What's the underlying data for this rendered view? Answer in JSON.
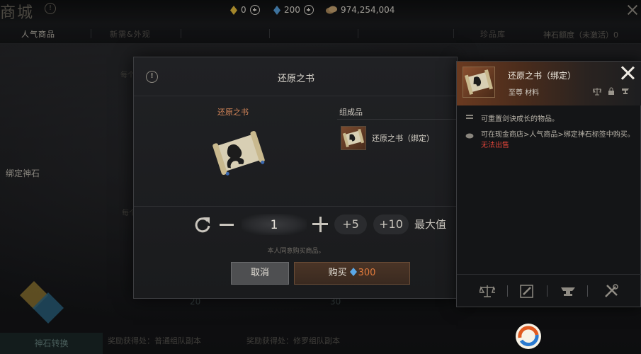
{
  "header": {
    "title": "商城",
    "help_icon": "!",
    "currencies": [
      {
        "icon": "gold-gem-icon",
        "value": "0",
        "color": "#f0c640"
      },
      {
        "icon": "blue-gem-icon",
        "value": "200",
        "color": "#5aa8e8"
      },
      {
        "icon": "coin-icon",
        "value": "974,254,004",
        "color": "#c9a46a"
      }
    ]
  },
  "tabs": [
    "人气商品",
    "新需&外观",
    "",
    "",
    "",
    "珍品库",
    ""
  ],
  "tab_right": "神石额度（未激活）0",
  "sidebar": {
    "items": [
      "",
      "",
      "",
      "",
      "绑定神石",
      "",
      ""
    ],
    "bottom_button": "神石转换"
  },
  "background": {
    "labels_mid": [
      "每个",
      "每个"
    ],
    "nums": [
      "20",
      "30"
    ],
    "footer": [
      {
        "title": "奖励获得处：普通组队副本",
        "sub": ""
      },
      {
        "title": "奖励获得处：修罗组队副本",
        "sub": ""
      },
      {
        "title": "",
        "sub": ""
      }
    ]
  },
  "dialog": {
    "title": "还原之书",
    "item_name": "还原之书",
    "composition_label": "组成品",
    "component_name": "还原之书（绑定）",
    "quantity": "1",
    "step_small": "+5",
    "step_large": "+10",
    "max_label": "最大值",
    "agree_text": "本人同意购买商品。",
    "cancel_label": "取消",
    "buy_label": "购买",
    "price": "300"
  },
  "tooltip": {
    "title": "还原之书（绑定）",
    "subtitle": "至尊 材料",
    "desc1": "可重置剑诀成长的物品。",
    "desc2": "可在现金商店>人气商品>绑定神石标签中购买。",
    "warning": "无法出售"
  },
  "colors": {
    "accent_orange": "#d9895a",
    "price_orange": "#e07a3c",
    "warning_red": "#e2453a"
  }
}
